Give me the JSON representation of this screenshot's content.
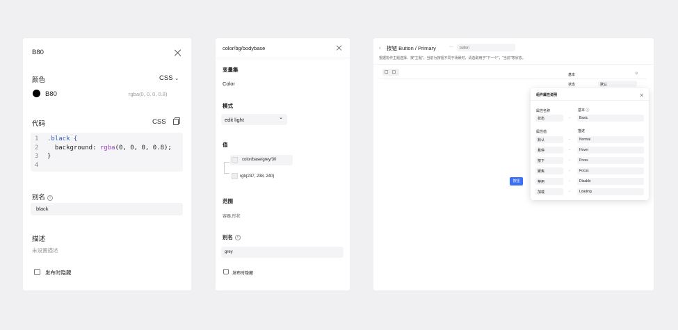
{
  "colorPanel": {
    "title": "B80",
    "colorLabel": "颜色",
    "formatSelect": "CSS",
    "colorName": "B80",
    "colorValue": "rgba(0, 0, 0, 0.8)",
    "codeLabel": "代码",
    "codeFormat": "CSS",
    "codeLines": [
      {
        "no": "1",
        "text": ".black {"
      },
      {
        "no": "2",
        "prop": "  background: ",
        "fn": "rgba",
        "args": "(0, 0, 0, 0.8);"
      },
      {
        "no": "3",
        "text": "}"
      },
      {
        "no": "4",
        "text": ""
      }
    ],
    "aliasLabel": "别名",
    "aliasValue": "black",
    "descLabel": "描述",
    "descPlaceholder": "未设置描述",
    "hideLabel": "发布时隐藏",
    "swatchColor": "#000000"
  },
  "variablePanel": {
    "title": "color/bg/bodybase",
    "collectionLabel": "变量集",
    "collectionValue": "Color",
    "modeLabel": "模式",
    "modeValue": "edit light",
    "valueLabel": "值",
    "refVariable": "color/base/grey/30",
    "rgbValue": "rgb(237, 238, 240)",
    "scopeLabel": "范围",
    "scopeValue": "容器,形状",
    "aliasLabel": "别名",
    "aliasValue": "grey",
    "hideLabel": "发布时隐藏"
  },
  "componentPanel": {
    "breadcrumb": "按钮 Button / Primary",
    "tag": "button",
    "description": "根据协作主题选择、按\"主题\"，当前为按钮不同于场景时，请选取用于\"下一个\"，\"当前\"等状态。",
    "previewButton": "按钮",
    "propSection": {
      "label1": "基本",
      "label2": "状态",
      "value2": "默认"
    },
    "popover": {
      "title": "组件属性说明",
      "propName": "属性名称",
      "propNameValue": "状态",
      "headerA": "属性值",
      "headerB": "值",
      "typeLabel": "基本 ⓘ",
      "typeValue": "Basic",
      "headerC": "属性值",
      "headerD": "描述",
      "rows": [
        {
          "name": "默认",
          "value": "Normal"
        },
        {
          "name": "悬停",
          "value": "Hover"
        },
        {
          "name": "按下",
          "value": "Press"
        },
        {
          "name": "聚焦",
          "value": "Focus"
        },
        {
          "name": "禁用",
          "value": "Disable"
        },
        {
          "name": "加载",
          "value": "Loading"
        }
      ]
    },
    "accentColor": "#3b6ff5"
  }
}
